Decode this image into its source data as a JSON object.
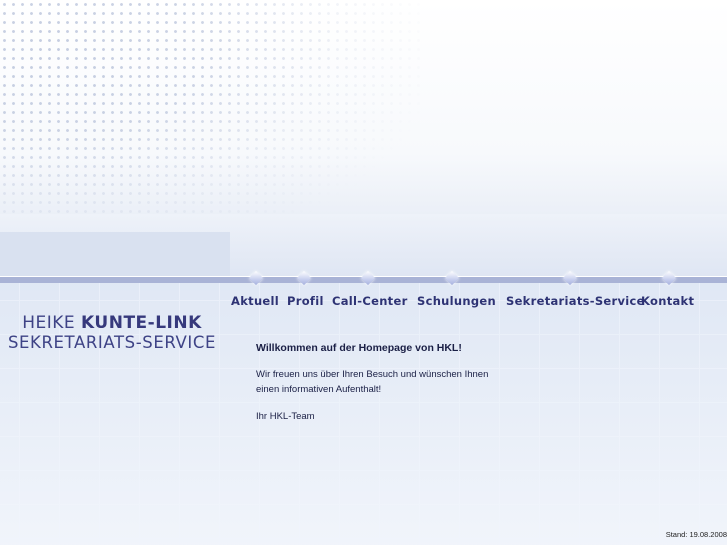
{
  "nav": {
    "items": [
      {
        "label": "Aktuell"
      },
      {
        "label": "Profil"
      },
      {
        "label": "Call-Center"
      },
      {
        "label": "Schulungen"
      },
      {
        "label": "Sekretariats-Service"
      },
      {
        "label": "Kontakt"
      }
    ]
  },
  "logo": {
    "name_light": "HEIKE",
    "name_bold": "KUNTE-LINK",
    "tagline": "SEKRETARIATS-SERVICE"
  },
  "content": {
    "welcome": "Willkommen auf der Homepage von HKL!",
    "paragraph_line1": "Wir freuen uns über Ihren Besuch und wünschen Ihnen",
    "paragraph_line2": "einen informativen Aufenthalt!",
    "signature": "Ihr HKL-Team"
  },
  "footer": {
    "stand": "Stand: 19.08.2008"
  },
  "colors": {
    "nav_text": "#2e3374",
    "rule": "#a9b3d6",
    "background": "#dce5f3"
  }
}
